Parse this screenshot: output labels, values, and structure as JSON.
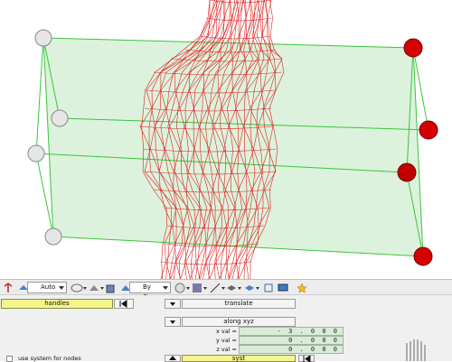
{
  "toolbar": {
    "view_mode": "Auto",
    "color_mode": "By Comp"
  },
  "panel": {
    "entity_selector": "handles",
    "operation": "translate",
    "direction": "along xyz",
    "fields": [
      {
        "label": "x val =",
        "value": "- 3 . 0 0 0"
      },
      {
        "label": "y val =",
        "value": "0 . 0 0 0"
      },
      {
        "label": "z val =",
        "value": "0 . 0 0 0"
      }
    ],
    "system_button": "syst",
    "use_system_label": "use system for nodes"
  },
  "colors": {
    "mesh": "#e02020",
    "box_fill": "#bfe8bf",
    "box_edge": "#3cc43c",
    "selected_handle": "#d40000",
    "handle": "#e0e0e0",
    "selector_bg": "#f5f58c"
  },
  "icons": [
    "toggle-icon",
    "view-icon",
    "lasso-icon",
    "shape-icon",
    "cube-icon",
    "sphere-icon",
    "grid-icon",
    "line-icon",
    "layer-icon",
    "monitor-icon",
    "star-icon"
  ]
}
